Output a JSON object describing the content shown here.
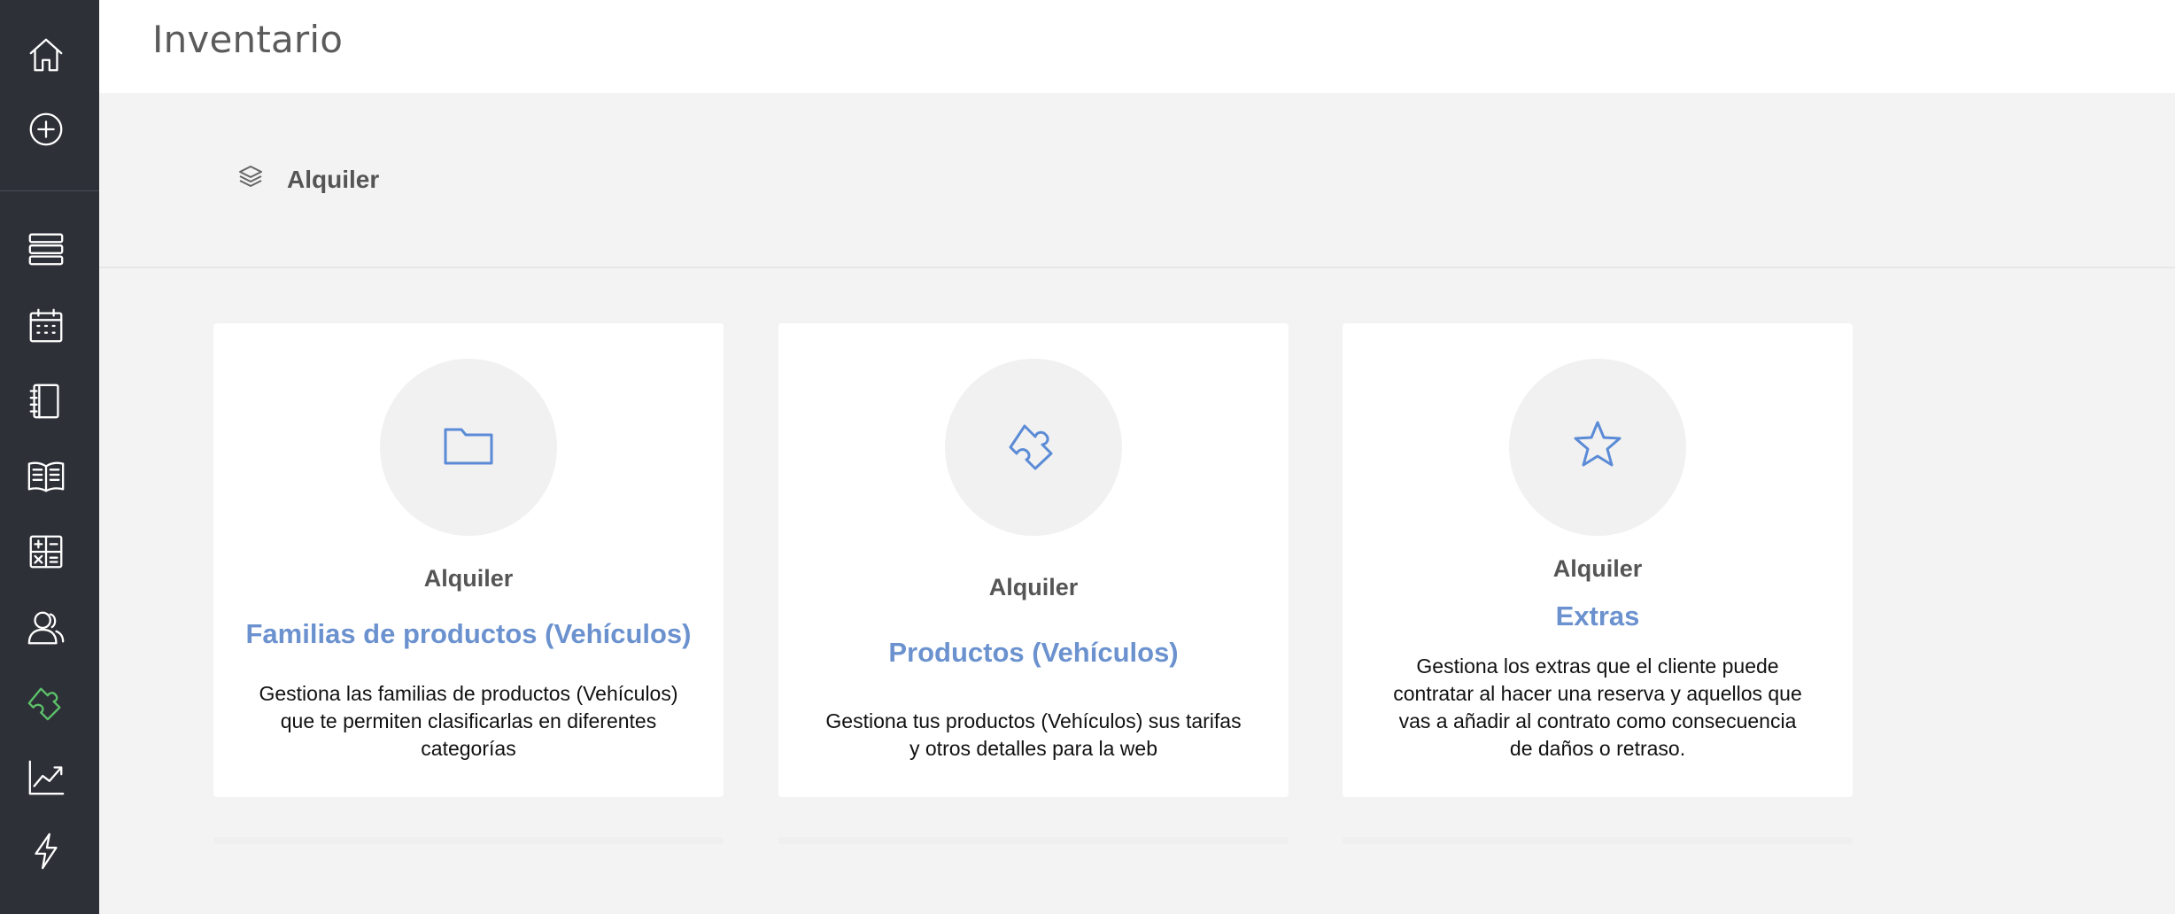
{
  "header": {
    "title": "Inventario"
  },
  "breadcrumb": {
    "icon": "layers-icon",
    "label": "Alquiler"
  },
  "sidebar": {
    "items": [
      {
        "name": "home-icon"
      },
      {
        "name": "add-circle-icon"
      },
      {
        "name": "servers-icon"
      },
      {
        "name": "calendar-icon"
      },
      {
        "name": "notebook-icon"
      },
      {
        "name": "book-open-icon"
      },
      {
        "name": "calculator-icon"
      },
      {
        "name": "users-icon"
      },
      {
        "name": "puzzle-icon",
        "active": true
      },
      {
        "name": "chart-line-icon"
      },
      {
        "name": "lightning-icon"
      }
    ],
    "active_color": "#5cc26a"
  },
  "cards": [
    {
      "icon": "folder-icon",
      "category": "Alquiler",
      "title": "Familias de productos (Vehículos)",
      "description": "Gestiona las familias de productos (Vehículos) que te permiten clasificarlas en diferentes categorías"
    },
    {
      "icon": "puzzle-icon",
      "category": "Alquiler",
      "title": "Productos (Vehículos)",
      "description": "Gestiona tus productos (Vehículos) sus tarifas y otros detalles para la web"
    },
    {
      "icon": "star-icon",
      "category": "Alquiler",
      "title": "Extras",
      "description": "Gestiona los extras que el cliente puede contratar al hacer una reserva y aquellos que vas a añadir al contrato como consecuencia de daños o retraso."
    }
  ],
  "colors": {
    "sidebar": "#2d3037",
    "accent": "#6b92cf",
    "icon": "#5b8bd6"
  }
}
